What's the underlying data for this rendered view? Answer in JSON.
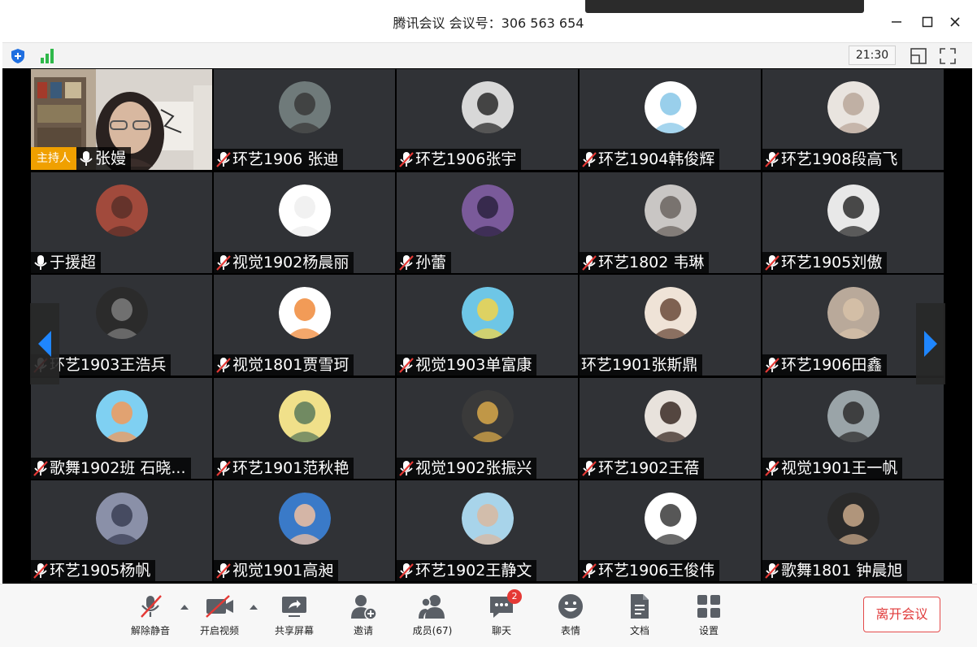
{
  "window": {
    "title": "腾讯会议 会议号：306 563 654",
    "minimize": "—",
    "maximize": "☐",
    "close": "✕"
  },
  "infobar": {
    "time": "21:30"
  },
  "host": {
    "badge": "主持人",
    "name": "张嫚"
  },
  "participants": [
    {
      "name": "环艺1906 张迪",
      "muted": true,
      "avatar": [
        "#6f7a7a",
        "#3a3a3a"
      ]
    },
    {
      "name": "环艺1906张宇",
      "muted": true,
      "avatar": [
        "#d8d8d8",
        "#2a2a2a"
      ]
    },
    {
      "name": "环艺1904韩俊辉",
      "muted": true,
      "avatar": [
        "#ffffff",
        "#87c7e8"
      ]
    },
    {
      "name": "环艺1908段高飞",
      "muted": true,
      "avatar": [
        "#e9e4df",
        "#b9a79a"
      ]
    },
    {
      "name": "于援超",
      "muted": false,
      "avatar": [
        "#a14a3c",
        "#5a2f28"
      ]
    },
    {
      "name": "视觉1902杨晨丽",
      "muted": true,
      "avatar": [
        "#ffffff",
        "#eeeeee"
      ]
    },
    {
      "name": "孙蕾",
      "muted": true,
      "avatar": [
        "#7a5a9a",
        "#2c2240"
      ]
    },
    {
      "name": "环艺1802 韦琳",
      "muted": true,
      "avatar": [
        "#c9c6c4",
        "#6b6460"
      ]
    },
    {
      "name": "环艺1905刘傲",
      "muted": true,
      "avatar": [
        "#e8e8e8",
        "#2b2b2b"
      ]
    },
    {
      "name": "环艺1903王浩兵",
      "muted": true,
      "avatar": [
        "#2b2b2b",
        "#7d7d7d"
      ]
    },
    {
      "name": "视觉1801贾雪珂",
      "muted": true,
      "avatar": [
        "#ffffff",
        "#f08a3a"
      ]
    },
    {
      "name": "视觉1903单富康",
      "muted": true,
      "avatar": [
        "#6ec6e6",
        "#f2d44a"
      ]
    },
    {
      "name": "环艺1901张斯鼎",
      "muted": false,
      "avatar": [
        "#efe3d7",
        "#6a4a3a"
      ]
    },
    {
      "name": "环艺1906田鑫",
      "muted": true,
      "avatar": [
        "#b9a99a",
        "#d7c2a8"
      ]
    },
    {
      "name": "歌舞1902班  石晓...",
      "muted": true,
      "avatar": [
        "#7fd0f2",
        "#f29a5a"
      ]
    },
    {
      "name": "环艺1901范秋艳",
      "muted": true,
      "avatar": [
        "#f0e08a",
        "#5a7a5a"
      ]
    },
    {
      "name": "视觉1902张振兴",
      "muted": true,
      "avatar": [
        "#3a3a3a",
        "#d8a84a"
      ]
    },
    {
      "name": "环艺1902王蓓",
      "muted": true,
      "avatar": [
        "#e8e2dc",
        "#3a2a24"
      ]
    },
    {
      "name": "视觉1901王一帆",
      "muted": true,
      "avatar": [
        "#9aa4a8",
        "#2e2e2e"
      ]
    },
    {
      "name": "环艺1905杨帆",
      "muted": true,
      "avatar": [
        "#8a90a8",
        "#3a3f55"
      ]
    },
    {
      "name": "视觉1901高昶",
      "muted": true,
      "avatar": [
        "#3a7ac8",
        "#f0c0a0"
      ]
    },
    {
      "name": "环艺1902王静文",
      "muted": true,
      "avatar": [
        "#a8d4ea",
        "#d9b8a0"
      ]
    },
    {
      "name": "环艺1906王俊伟",
      "muted": true,
      "avatar": [
        "#ffffff",
        "#3a3a3a"
      ]
    },
    {
      "name": "歌舞1801 钟晨旭",
      "muted": true,
      "avatar": [
        "#2a2a2a",
        "#c8a88a"
      ]
    }
  ],
  "toolbar": {
    "unmute": "解除静音",
    "video": "开启视频",
    "share": "共享屏幕",
    "invite": "邀请",
    "members": "成员(67)",
    "chat": "聊天",
    "chat_badge": "2",
    "emoji": "表情",
    "docs": "文档",
    "settings": "设置",
    "leave": "离开会议"
  },
  "colors": {
    "accent": "#1f86ff",
    "leave": "#e03a3a",
    "host_badge": "#f0a000",
    "badge": "#e53935"
  }
}
